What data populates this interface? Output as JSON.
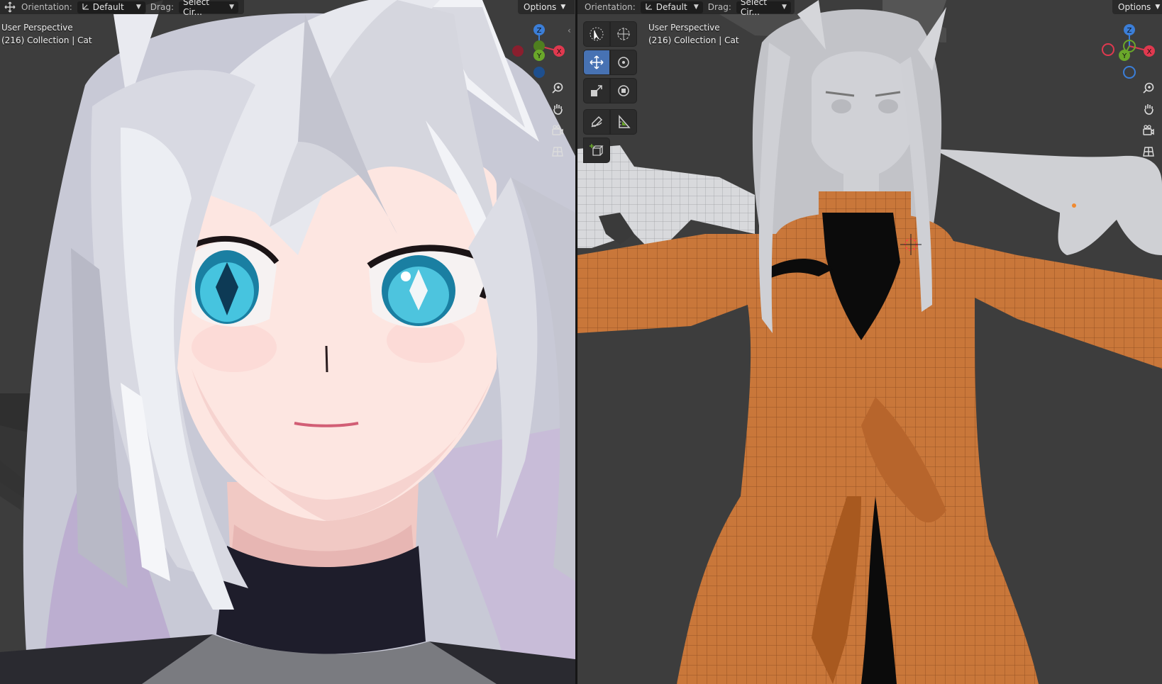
{
  "left_viewport": {
    "header": {
      "orientation_label": "Orientation:",
      "orientation_value": "Default",
      "drag_label": "Drag:",
      "drag_value": "Select Cir...",
      "options_label": "Options"
    },
    "info_line1": "User Perspective",
    "info_line2": "(216) Collection | Cat"
  },
  "right_viewport": {
    "header": {
      "orientation_label": "Orientation:",
      "orientation_value": "Default",
      "drag_label": "Drag:",
      "drag_value": "Select Cir...",
      "options_label": "Options"
    },
    "info_line1": "User Perspective",
    "info_line2": "(216) Collection | Cat"
  },
  "gizmo": {
    "z": "Z",
    "y": "Y",
    "x": "X"
  },
  "colors": {
    "x_axis": "#e0394f",
    "y_axis": "#6aa72a",
    "z_axis": "#3b7ed8",
    "active_tool": "#4772b3",
    "viewport_bg": "#3d3d3d",
    "clothing_orange": "#c9773a"
  },
  "icons": [
    "transform-icon",
    "orientation-icon",
    "chevron-down-icon",
    "zoom-icon",
    "hand-pan-icon",
    "camera-icon",
    "perspective-grid-icon",
    "select-circle-icon",
    "cursor-icon",
    "move-icon",
    "rotate-icon",
    "scale-icon",
    "transform-icon",
    "annotate-icon",
    "measure-icon",
    "add-cube-icon"
  ]
}
